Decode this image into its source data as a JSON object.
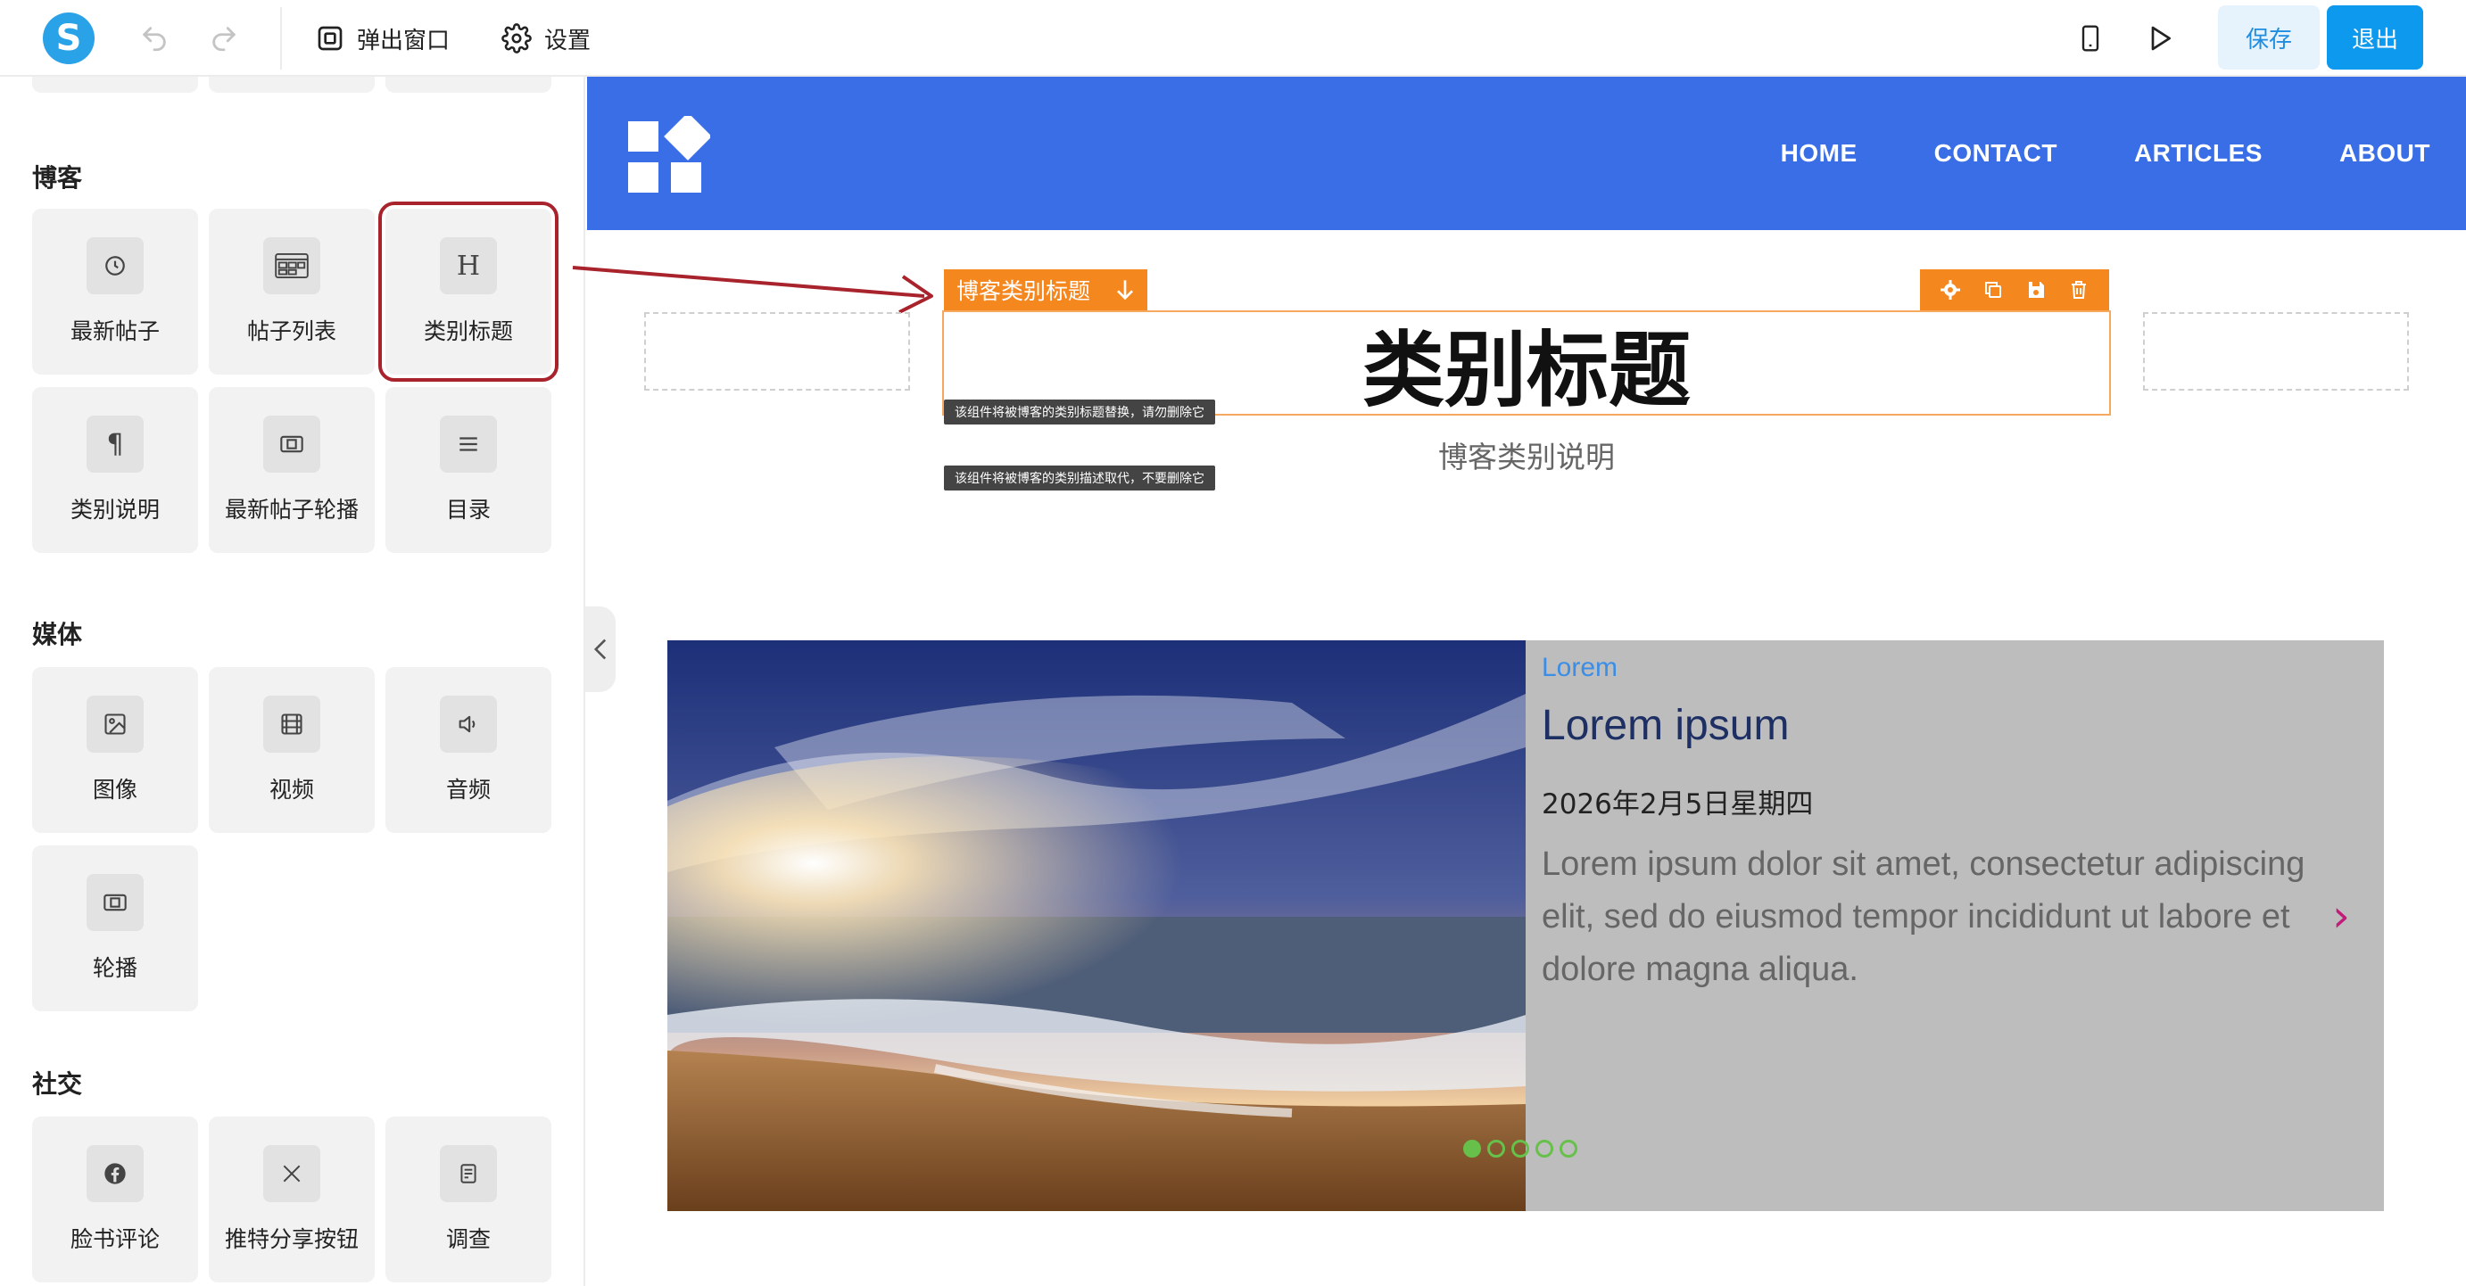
{
  "topbar": {
    "logo_letter": "S",
    "popup_label": "弹出窗口",
    "settings_label": "设置",
    "save_label": "保存",
    "exit_label": "退出"
  },
  "sidebar": {
    "blog_title": "博客",
    "blog_items": [
      "最新帖子",
      "帖子列表",
      "类别标题",
      "类别说明",
      "最新帖子轮播",
      "目录"
    ],
    "media_title": "媒体",
    "media_items": [
      "图像",
      "视频",
      "音频",
      "轮播"
    ],
    "social_title": "社交",
    "social_items": [
      "脸书评论",
      "推特分享按钮",
      "调查"
    ]
  },
  "site": {
    "nav": [
      "HOME",
      "CONTACT",
      "ARTICLES",
      "ABOUT"
    ],
    "selected_block_label": "博客类别标题",
    "heading": "类别标题",
    "heading_notice": "该组件将被博客的类别标题替换，请勿删除它",
    "description": "博客类别说明",
    "description_notice": "该组件将被博客的类别描述取代，不要删除它"
  },
  "card": {
    "category": "Lorem",
    "title": "Lorem ipsum",
    "date": "2026年2月5日星期四",
    "body": "Lorem ipsum dolor sit amet, consectetur adipiscing elit, sed do eiusmod tempor incididunt ut labore et dolore magna aliqua.",
    "slide_count": 5,
    "active_slide": 1
  },
  "colors": {
    "accent_blue": "#0d99ee",
    "site_header": "#3a6ee6",
    "selection_orange": "#f5871f",
    "highlight_red": "#a8232c",
    "dot_green": "#66c04a"
  }
}
